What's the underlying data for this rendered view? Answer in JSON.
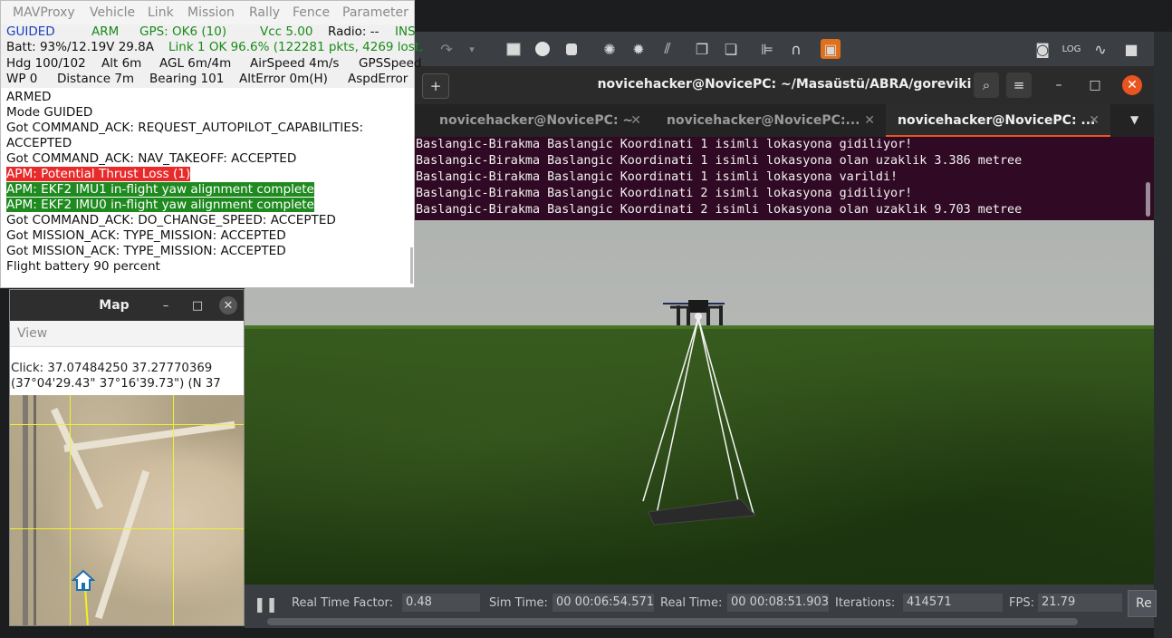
{
  "mavproxy": {
    "menu": [
      "MAVProxy",
      "Vehicle",
      "Link",
      "Mission",
      "Rally",
      "Fence",
      "Parameter"
    ],
    "status": {
      "mode": "GUIDED",
      "arm": "ARM",
      "gps": "GPS: OK6 (10)",
      "vcc": "Vcc 5.00",
      "radio": "Radio: --",
      "ins": "INS",
      "batt": "Batt: 93%/12.19V 29.8A",
      "link": "Link 1 OK 96.6% (122281 pkts, 4269 lost,",
      "hdg": "Hdg 100/102",
      "alt": "Alt 6m",
      "agl": "AGL 6m/4m",
      "airspeed": "AirSpeed 4m/s",
      "gpsspeed": "GPSSpeed",
      "wp": "WP 0",
      "distance": "Distance 7m",
      "bearing": "Bearing 101",
      "alterror": "AltError 0m(H)",
      "aspderror": "AspdError"
    },
    "log": [
      "ARMED",
      "Mode GUIDED",
      "Got COMMAND_ACK: REQUEST_AUTOPILOT_CAPABILITIES:",
      "ACCEPTED",
      "Got COMMAND_ACK: NAV_TAKEOFF: ACCEPTED",
      "APM: Potential Thrust Loss (1)",
      "APM: EKF2 IMU1 in-flight yaw alignment complete",
      "APM: EKF2 IMU0 in-flight yaw alignment complete",
      "Got COMMAND_ACK: DO_CHANGE_SPEED: ACCEPTED",
      "Got MISSION_ACK: TYPE_MISSION: ACCEPTED",
      "Got MISSION_ACK: TYPE_MISSION: ACCEPTED",
      "Flight battery 90 percent"
    ]
  },
  "map": {
    "title": "Map",
    "menu": "View",
    "click_line1": "Click: 37.07484250 37.27770369",
    "click_line2": "(37°04'29.43\" 37°16'39.73\") (N 37"
  },
  "terminal": {
    "title": "novicehacker@NovicePC: ~/Masaüstü/ABRA/goreviki",
    "tabs": [
      "novicehacker@NovicePC: ~",
      "novicehacker@NovicePC:...",
      "novicehacker@NovicePC: ..."
    ],
    "lines": [
      "Baslangic-Birakma Baslangic Koordinati 1 isimli lokasyona gidiliyor!",
      "Baslangic-Birakma Baslangic Koordinati 1 isimli lokasyona olan uzaklik 3.386 metree",
      "Baslangic-Birakma Baslangic Koordinati 1 isimli lokasyona varildi!",
      "Baslangic-Birakma Baslangic Koordinati 2 isimli lokasyona gidiliyor!",
      "Baslangic-Birakma Baslangic Koordinati 2 isimli lokasyona olan uzaklik 9.703 metree"
    ]
  },
  "gazebo": {
    "real_time_factor_label": "Real Time Factor:",
    "real_time_factor": "0.48",
    "sim_time_label": "Sim Time:",
    "sim_time": "00 00:06:54.571",
    "real_time_label": "Real Time:",
    "real_time": "00 00:08:51.903",
    "iterations_label": "Iterations:",
    "iterations": "414571",
    "fps_label": "FPS:",
    "fps": "21.79",
    "reset_label": "Re"
  },
  "colors": {
    "mode": "#1a3fbf",
    "green_text": "#1a8a1a",
    "terminal_bg": "#300a24",
    "accent": "#e95420"
  }
}
